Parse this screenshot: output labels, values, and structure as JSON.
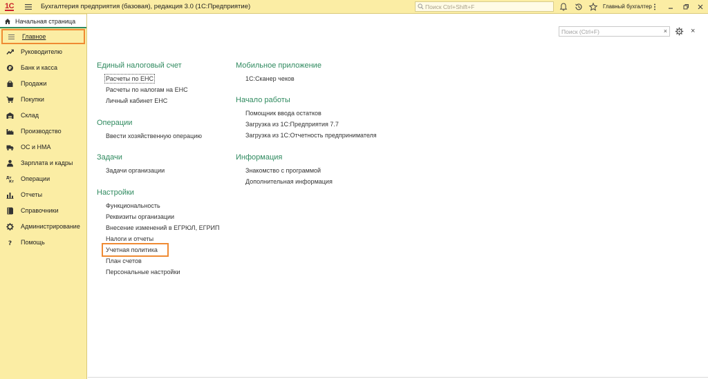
{
  "titlebar": {
    "logo": "1С",
    "app_title": "Бухгалтерия предприятия (базовая), редакция 3.0  (1С:Предприятие)",
    "search_placeholder": "Поиск Ctrl+Shift+F",
    "user_name": "Главный бухгалтер",
    "icons": [
      "menu-icon",
      "bell-icon",
      "history-icon",
      "star-icon",
      "more-icon",
      "minimize-icon",
      "restore-icon",
      "close-icon"
    ]
  },
  "sidebar": {
    "home_tab": "Начальная страница",
    "items": [
      {
        "label": "Главное",
        "icon": "list-icon"
      },
      {
        "label": "Руководителю",
        "icon": "trend-icon"
      },
      {
        "label": "Банк и касса",
        "icon": "coin-icon"
      },
      {
        "label": "Продажи",
        "icon": "bag-icon"
      },
      {
        "label": "Покупки",
        "icon": "cart-icon"
      },
      {
        "label": "Склад",
        "icon": "warehouse-icon"
      },
      {
        "label": "Производство",
        "icon": "factory-icon"
      },
      {
        "label": "ОС и НМА",
        "icon": "truck-icon"
      },
      {
        "label": "Зарплата и кадры",
        "icon": "person-icon"
      },
      {
        "label": "Операции",
        "icon": "dtkt-icon"
      },
      {
        "label": "Отчеты",
        "icon": "bar-chart-icon"
      },
      {
        "label": "Справочники",
        "icon": "book-icon"
      },
      {
        "label": "Администрирование",
        "icon": "gear-icon"
      },
      {
        "label": "Помощь",
        "icon": "help-icon"
      }
    ]
  },
  "main": {
    "search_placeholder": "Поиск (Ctrl+F)",
    "clear_glyph": "×",
    "close_glyph": "×",
    "left_column": [
      {
        "title": "Единый налоговый счет",
        "links": [
          "Расчеты по ЕНС",
          "Расчеты по налогам на ЕНС",
          "Личный кабинет ЕНС"
        ]
      },
      {
        "title": "Операции",
        "links": [
          "Ввести хозяйственную операцию"
        ]
      },
      {
        "title": "Задачи",
        "links": [
          "Задачи организации"
        ]
      },
      {
        "title": "Настройки",
        "links": [
          "Функциональность",
          "Реквизиты организации",
          "Внесение изменений в ЕГРЮЛ, ЕГРИП",
          "Налоги и отчеты",
          "Учетная политика",
          "План счетов",
          "Персональные настройки"
        ]
      }
    ],
    "right_column": [
      {
        "title": "Мобильное приложение",
        "links": [
          "1С:Сканер чеков"
        ]
      },
      {
        "title": "Начало работы",
        "links": [
          "Помощник ввода остатков",
          "Загрузка из 1С:Предприятия 7.7",
          "Загрузка из 1С:Отчетность предпринимателя"
        ]
      },
      {
        "title": "Информация",
        "links": [
          "Знакомство с программой",
          "Дополнительная информация"
        ]
      }
    ]
  },
  "colors": {
    "accent_green": "#2f8a5f",
    "highlight_orange": "#ef8a32",
    "panel_yellow": "#fbeda4"
  }
}
